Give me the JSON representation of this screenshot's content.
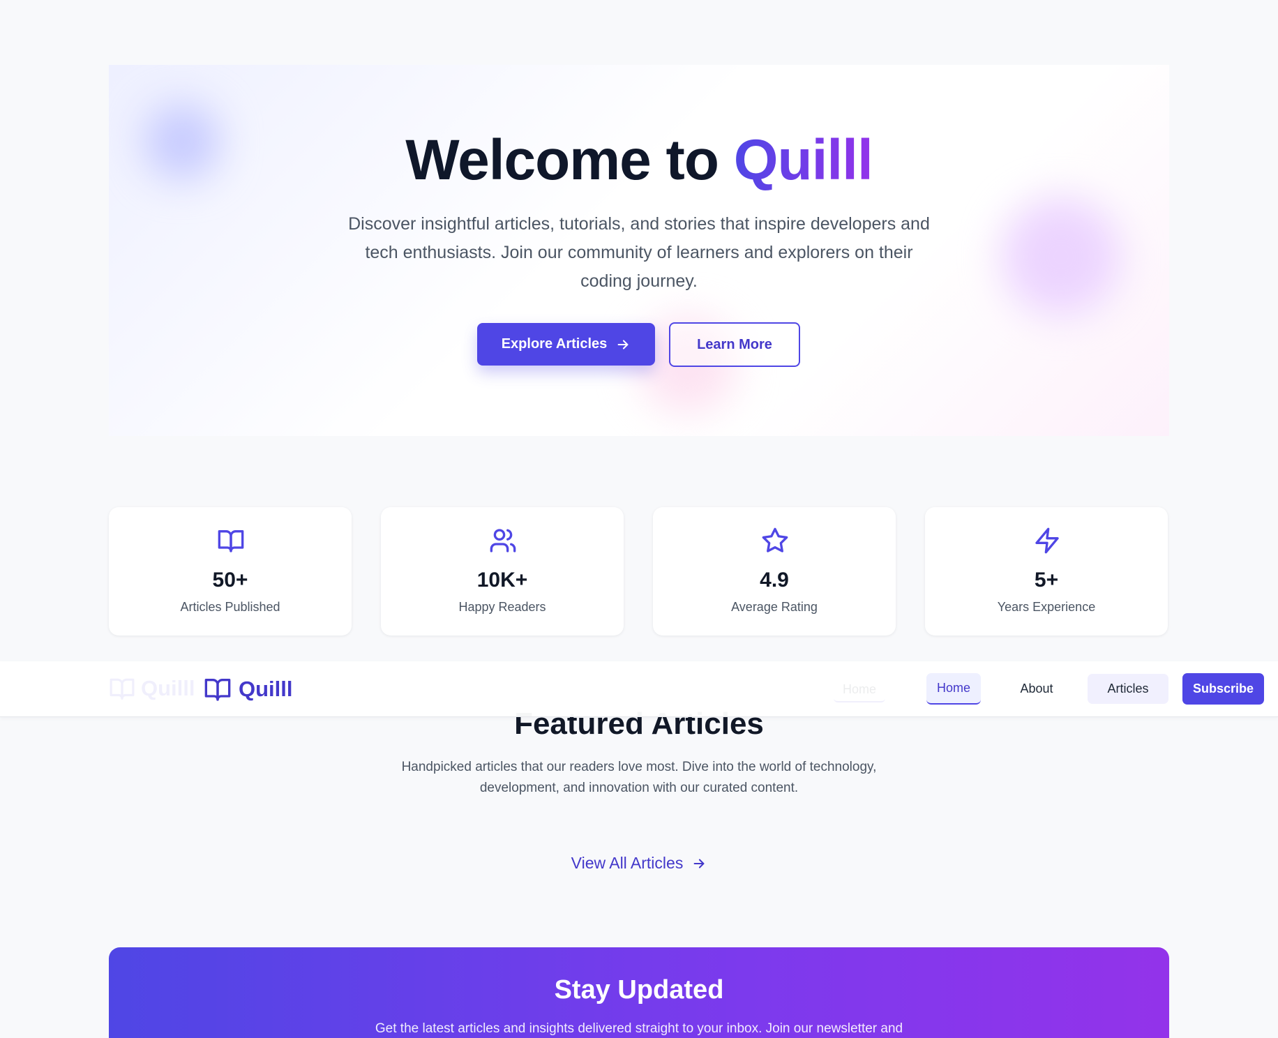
{
  "hero": {
    "title_prefix": "Welcome to ",
    "title_brand": "Quilll",
    "subtitle": "Discover insightful articles, tutorials, and stories that inspire developers and tech enthusiasts. Join our community of learners and explorers on their coding journey.",
    "primary_button": "Explore Articles",
    "secondary_button": "Learn More"
  },
  "stats": [
    {
      "icon": "book-open-icon",
      "value": "50+",
      "label": "Articles Published"
    },
    {
      "icon": "users-icon",
      "value": "10K+",
      "label": "Happy Readers"
    },
    {
      "icon": "star-icon",
      "value": "4.9",
      "label": "Average Rating"
    },
    {
      "icon": "zap-icon",
      "value": "5+",
      "label": "Years Experience"
    }
  ],
  "navbar": {
    "logo_text": "Quilll",
    "items": [
      {
        "label": "Home",
        "active": true
      },
      {
        "label": "About",
        "active": false
      },
      {
        "label": "Articles",
        "active": false
      }
    ],
    "cta": "Subscribe"
  },
  "featured": {
    "title": "Featured Articles",
    "subtitle": "Handpicked articles that our readers love most. Dive into the world of technology, development, and innovation with our curated content.",
    "view_all": "View All Articles"
  },
  "newsletter": {
    "title": "Stay Updated",
    "subtitle": "Get the latest articles and insights delivered straight to your inbox. Join our newsletter and"
  },
  "colors": {
    "accent": "#4f46e5",
    "accent_purple": "#9333ea",
    "background": "#f8f9fb"
  }
}
